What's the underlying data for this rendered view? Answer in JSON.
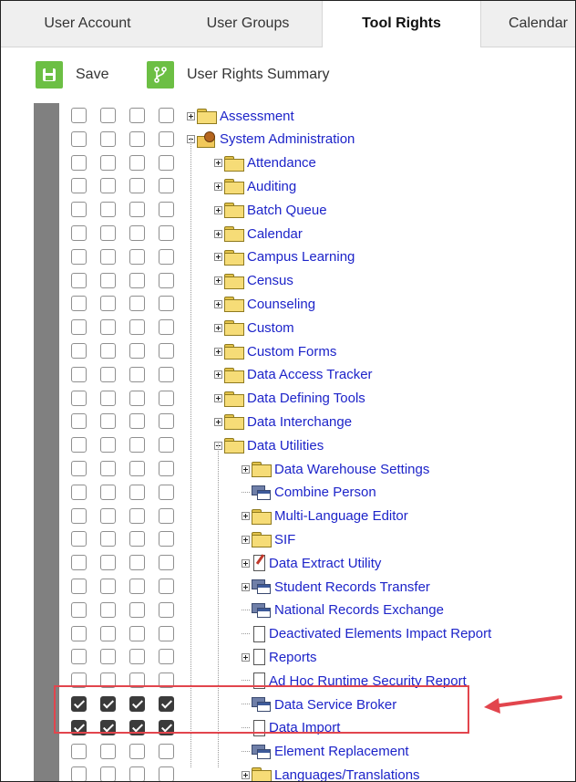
{
  "tabs": [
    {
      "label": "User Account",
      "active": false
    },
    {
      "label": "User Groups",
      "active": false
    },
    {
      "label": "Tool Rights",
      "active": true
    },
    {
      "label": "Calendar",
      "active": false
    }
  ],
  "toolbar": {
    "save_label": "Save",
    "summary_label": "User Rights Summary"
  },
  "tree": [
    {
      "label": "Assessment",
      "icon": "folder-icon",
      "expander": "plus",
      "checked": [
        false,
        false,
        false,
        false
      ]
    },
    {
      "label": "System Administration",
      "icon": "system-admin-icon",
      "expander": "minus",
      "checked": [
        false,
        false,
        false,
        false
      ]
    },
    {
      "label": "Attendance",
      "icon": "folder-icon",
      "expander": "plus",
      "checked": [
        false,
        false,
        false,
        false
      ]
    },
    {
      "label": "Auditing",
      "icon": "folder-icon",
      "expander": "plus",
      "checked": [
        false,
        false,
        false,
        false
      ]
    },
    {
      "label": "Batch Queue",
      "icon": "folder-icon",
      "expander": "plus",
      "checked": [
        false,
        false,
        false,
        false
      ]
    },
    {
      "label": "Calendar",
      "icon": "folder-icon",
      "expander": "plus",
      "checked": [
        false,
        false,
        false,
        false
      ]
    },
    {
      "label": "Campus Learning",
      "icon": "folder-icon",
      "expander": "plus",
      "checked": [
        false,
        false,
        false,
        false
      ]
    },
    {
      "label": "Census",
      "icon": "folder-icon",
      "expander": "plus",
      "checked": [
        false,
        false,
        false,
        false
      ]
    },
    {
      "label": "Counseling",
      "icon": "folder-icon",
      "expander": "plus",
      "checked": [
        false,
        false,
        false,
        false
      ]
    },
    {
      "label": "Custom",
      "icon": "folder-icon",
      "expander": "plus",
      "checked": [
        false,
        false,
        false,
        false
      ]
    },
    {
      "label": "Custom Forms",
      "icon": "folder-icon",
      "expander": "plus",
      "checked": [
        false,
        false,
        false,
        false
      ]
    },
    {
      "label": "Data Access Tracker",
      "icon": "folder-icon",
      "expander": "plus",
      "checked": [
        false,
        false,
        false,
        false
      ]
    },
    {
      "label": "Data Defining Tools",
      "icon": "folder-icon",
      "expander": "plus",
      "checked": [
        false,
        false,
        false,
        false
      ]
    },
    {
      "label": "Data Interchange",
      "icon": "folder-icon",
      "expander": "plus",
      "checked": [
        false,
        false,
        false,
        false
      ]
    },
    {
      "label": "Data Utilities",
      "icon": "folder-icon",
      "expander": "minus",
      "checked": [
        false,
        false,
        false,
        false
      ]
    },
    {
      "label": "Data Warehouse Settings",
      "icon": "folder-icon",
      "expander": "plus",
      "checked": [
        false,
        false,
        false,
        false
      ]
    },
    {
      "label": "Combine Person",
      "icon": "window-icon",
      "expander": "none",
      "checked": [
        false,
        false,
        false,
        false
      ]
    },
    {
      "label": "Multi-Language Editor",
      "icon": "folder-icon",
      "expander": "plus",
      "checked": [
        false,
        false,
        false,
        false
      ]
    },
    {
      "label": "SIF",
      "icon": "folder-icon",
      "expander": "plus",
      "checked": [
        false,
        false,
        false,
        false
      ]
    },
    {
      "label": "Data Extract Utility",
      "icon": "edit-document-icon",
      "expander": "plus",
      "checked": [
        false,
        false,
        false,
        false
      ]
    },
    {
      "label": "Student Records Transfer",
      "icon": "window-icon",
      "expander": "plus",
      "checked": [
        false,
        false,
        false,
        false
      ]
    },
    {
      "label": "National Records Exchange",
      "icon": "window-icon",
      "expander": "none",
      "checked": [
        false,
        false,
        false,
        false
      ]
    },
    {
      "label": "Deactivated Elements Impact Report",
      "icon": "document-icon",
      "expander": "none",
      "checked": [
        false,
        false,
        false,
        false
      ]
    },
    {
      "label": "Reports",
      "icon": "document-icon",
      "expander": "plus",
      "checked": [
        false,
        false,
        false,
        false
      ]
    },
    {
      "label": "Ad Hoc Runtime Security Report",
      "icon": "document-icon",
      "expander": "none",
      "checked": [
        false,
        false,
        false,
        false
      ]
    },
    {
      "label": "Data Service Broker",
      "icon": "window-icon",
      "expander": "none",
      "checked": [
        true,
        true,
        true,
        true
      ]
    },
    {
      "label": "Data Import",
      "icon": "document-icon",
      "expander": "none",
      "checked": [
        true,
        true,
        true,
        true
      ]
    },
    {
      "label": "Element Replacement",
      "icon": "window-icon",
      "expander": "none",
      "checked": [
        false,
        false,
        false,
        false
      ]
    },
    {
      "label": "Languages/Translations",
      "icon": "folder-icon",
      "expander": "plus",
      "checked": [
        false,
        false,
        false,
        false
      ]
    }
  ],
  "colors": {
    "accent": "#6cbf44",
    "link": "#1d24c9",
    "highlight": "#e2454d"
  }
}
